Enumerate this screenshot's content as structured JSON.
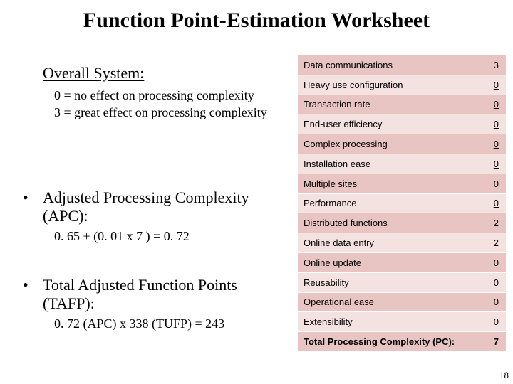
{
  "title": "Function Point-Estimation Worksheet",
  "overall_heading": "Overall System:",
  "scale_0": "0 = no effect on processing complexity",
  "scale_3": "3 = great effect on processing complexity",
  "apc": {
    "label": "Adjusted Processing Complexity (APC):",
    "formula": "0. 65 + (0. 01 x 7 ) = 0. 72"
  },
  "tafp": {
    "label": "Total Adjusted Function Points (TAFP):",
    "formula": "0. 72 (APC) x 338 (TUFP) = 243"
  },
  "factors": [
    {
      "name": "Data communications",
      "value": "3",
      "u": false
    },
    {
      "name": "Heavy use configuration",
      "value": "0",
      "u": true
    },
    {
      "name": "Transaction rate",
      "value": "0",
      "u": true
    },
    {
      "name": "End-user efficiency",
      "value": "0",
      "u": true
    },
    {
      "name": "Complex processing",
      "value": "0",
      "u": true
    },
    {
      "name": "Installation ease",
      "value": "0",
      "u": true
    },
    {
      "name": "Multiple sites",
      "value": "0",
      "u": true
    },
    {
      "name": "Performance",
      "value": "0",
      "u": true
    },
    {
      "name": "Distributed functions",
      "value": "2",
      "u": false
    },
    {
      "name": "Online data entry",
      "value": "2",
      "u": false
    },
    {
      "name": "Online update",
      "value": "0",
      "u": true
    },
    {
      "name": "Reusability",
      "value": "0",
      "u": true
    },
    {
      "name": "Operational ease",
      "value": "0",
      "u": true
    },
    {
      "name": "Extensibility",
      "value": "0",
      "u": true
    }
  ],
  "total": {
    "label": "Total Processing Complexity (PC):",
    "value": "7"
  },
  "page_number": "18"
}
